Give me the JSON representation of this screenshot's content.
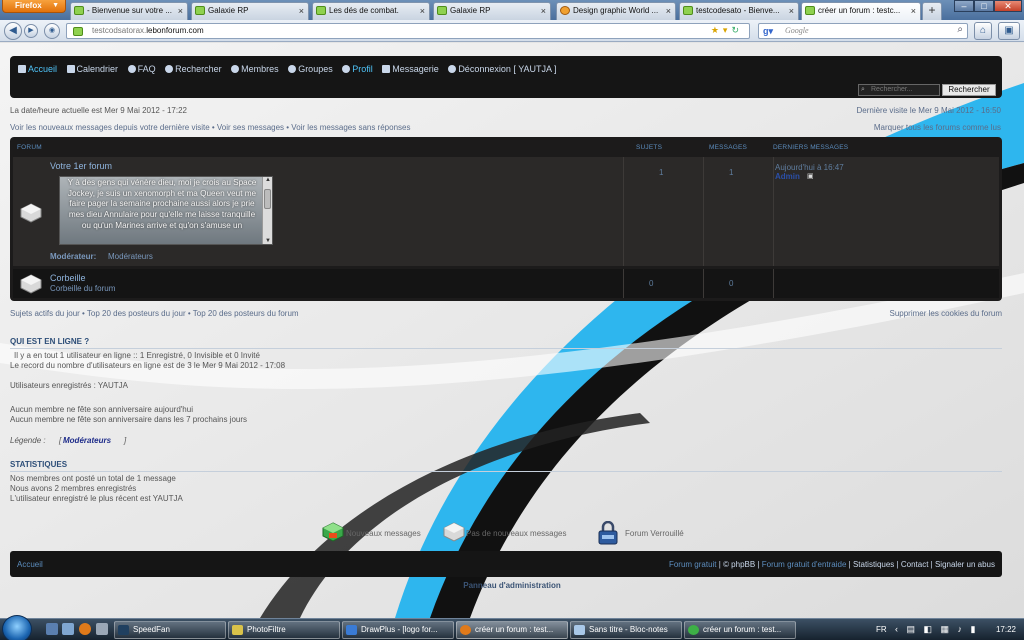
{
  "browser": {
    "menu_button": "Firefox",
    "tabs": [
      {
        "title": "- Bienvenue sur votre ..."
      },
      {
        "title": "Galaxie RP"
      },
      {
        "title": "Les dés de combat."
      },
      {
        "title": "Galaxie RP"
      },
      {
        "title": "Design graphic World ..."
      },
      {
        "title": "testcodesato - Bienve..."
      },
      {
        "title": "créer un forum : testc..."
      }
    ],
    "new_tab": "+",
    "url_prefix": "testcodsatorax.",
    "url_domain": "lebonforum.com",
    "search_placeholder": "Google"
  },
  "forum": {
    "nav": {
      "home": "Accueil",
      "calendar": "Calendrier",
      "faq": "FAQ",
      "search": "Rechercher",
      "members": "Membres",
      "groups": "Groupes",
      "profile": "Profil",
      "messaging": "Messagerie",
      "logout": "Déconnexion [ YAUTJA ]"
    },
    "search_placeholder": "Rechercher...",
    "search_button": "Rechercher",
    "current_time": "La date/heure actuelle est Mer 9 Mai 2012 - 17:22",
    "last_visit": "Dernière visite le Mer 9 Mai 2012 - 16:50",
    "new_messages_links": "Voir les nouveaux messages depuis votre dernière visite • Voir ses messages • Voir les messages sans réponses",
    "mark_all_read": "Marquer tous les forums comme lus",
    "table_headers": {
      "forum": "FORUM",
      "topics": "SUJETS",
      "messages": "MESSAGES",
      "last": "DERNIERS MESSAGES"
    },
    "forums": [
      {
        "title": "Votre 1er forum",
        "description": "Y à des gens qui vénère dieu, moi je crois au Space Jockey, je suis un xenomorph et ma Queen veut me faire pager la semaine prochaine aussi alors je prie mes dieu Annulaire pour qu'elle me laisse tranquille ou qu'un Marines arrive et qu'on s'amuse un",
        "moderator_label": "Modérateur:",
        "moderator_value": "Modérateurs",
        "topics": "1",
        "messages": "1",
        "last_post_date": "Aujourd'hui à 16:47",
        "last_post_author": "Admin"
      },
      {
        "title": "Corbeille",
        "description": "Corbeille du forum",
        "topics": "0",
        "messages": "0"
      }
    ],
    "active_links": "Sujets actifs du jour • Top 20 des posteurs du jour • Top 20 des posteurs du forum",
    "delete_cookies": "Supprimer les cookies du forum",
    "who_online": {
      "heading": "QUI EST EN LIGNE ?",
      "line1": "Il y a en tout 1 utilisateur en ligne :: 1 Enregistré, 0 Invisible et 0 Invité",
      "line2": "Le record du nombre d'utilisateurs en ligne est de 3 le Mer 9 Mai 2012 - 17:08",
      "registered": "Utilisateurs enregistrés : YAUTJA",
      "birthday_today": "Aucun membre ne fête son anniversaire aujourd'hui",
      "birthday_week": "Aucun membre ne fête son anniversaire dans les 7 prochains jours",
      "legend_label": "Légende :",
      "legend_value": "Modérateurs"
    },
    "stats": {
      "heading": "STATISTIQUES",
      "line1": "Nos membres ont posté un total de 1 message",
      "line2": "Nous avons 2 membres enregistrés",
      "line3": "L'utilisateur enregistré le plus récent est YAUTJA"
    },
    "legend_icons": {
      "new": "Nouveaux messages",
      "none": "Pas de nouveaux messages",
      "locked": "Forum Verrouillé"
    },
    "footer": {
      "home": "Accueil",
      "links": [
        "Forum gratuit",
        "© phpBB",
        "Forum gratuit d'entraide",
        "Statistiques",
        "Contact",
        "Signaler un abus"
      ]
    },
    "admin_panel": "Panneau d'administration"
  },
  "taskbar": {
    "items": [
      "SpeedFan",
      "PhotoFiltre",
      "DrawPlus - [logo for...",
      "créer un forum : test...",
      "Sans titre - Bloc-notes",
      "créer un forum : test..."
    ],
    "lang": "FR",
    "clock": "17:22"
  },
  "colors": {
    "accent_blue": "#1ab0ee",
    "forum_table_bg": "#1c1b1b",
    "link_color": "#5a6c8a"
  }
}
